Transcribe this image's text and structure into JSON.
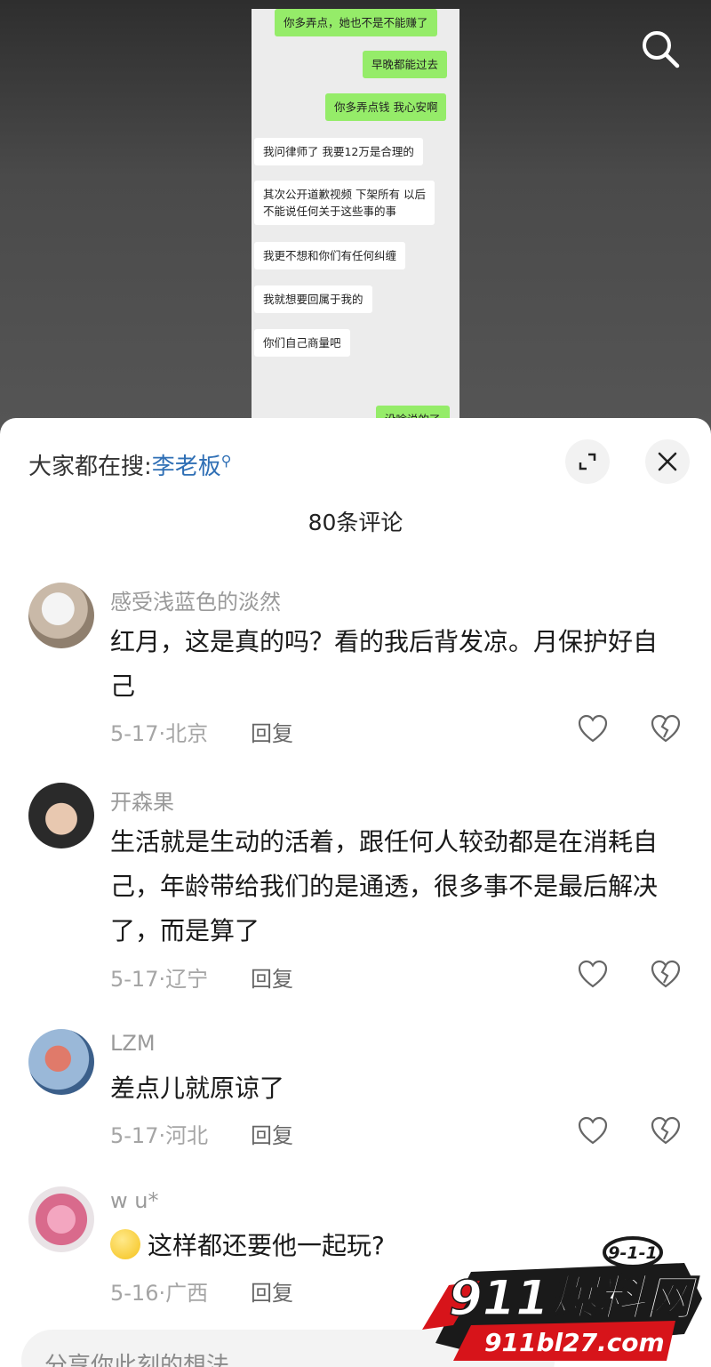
{
  "chat_screenshot": {
    "messages": [
      {
        "side": "green",
        "text": "你多弄点，她也不是不能赚了"
      },
      {
        "side": "green",
        "text": "早晚都能过去"
      },
      {
        "side": "green",
        "text": "你多弄点钱 我心安啊"
      },
      {
        "side": "white",
        "text": "我问律师了 我要12万是合理的"
      },
      {
        "side": "white",
        "text": "其次公开道歉视频 下架所有 以后\n不能说任何关于这些事的事"
      },
      {
        "side": "white",
        "text": "我更不想和你们有任何纠缠"
      },
      {
        "side": "white",
        "text": "我就想要回属于我的"
      },
      {
        "side": "white",
        "text": "你们自己商量吧"
      },
      {
        "side": "green",
        "text": "没啥说的了"
      }
    ]
  },
  "icons": {
    "search": "search-icon",
    "expand": "expand-icon",
    "close": "close-icon",
    "like": "heart-icon",
    "dislike": "broken-heart-icon"
  },
  "hot_search": {
    "prefix": "大家都在搜:",
    "keyword": "李老板",
    "suffix_icon": "search-small-icon"
  },
  "comment_count": "80条评论",
  "comments": [
    {
      "user": "感受浅蓝色的淡然",
      "text": "红月，这是真的吗？看的我后背发凉。月保护好自己",
      "meta": "5-17·北京",
      "reply": "回复"
    },
    {
      "user": "开森果",
      "text": "生活就是生动的活着，跟任何人较劲都是在消耗自己，年龄带给我们的是通透，很多事不是最后解决了，而是算了",
      "meta": "5-17·辽宁",
      "reply": "回复"
    },
    {
      "user": "LZM",
      "text": "差点儿就原谅了",
      "meta": "5-17·河北",
      "reply": "回复"
    },
    {
      "user": "w u*",
      "text": "这样都还要他一起玩?",
      "meta": "5-16·广西",
      "reply": "回复"
    }
  ],
  "input": {
    "placeholder": "分享你此刻的想法"
  },
  "watermark": {
    "badge": "9-1-1",
    "title": "911爆料网",
    "url": "911bl27.com"
  },
  "colors": {
    "keyword": "#2f6fb5",
    "wechat_green": "#95ec69",
    "watermark_red": "#d7141a"
  }
}
